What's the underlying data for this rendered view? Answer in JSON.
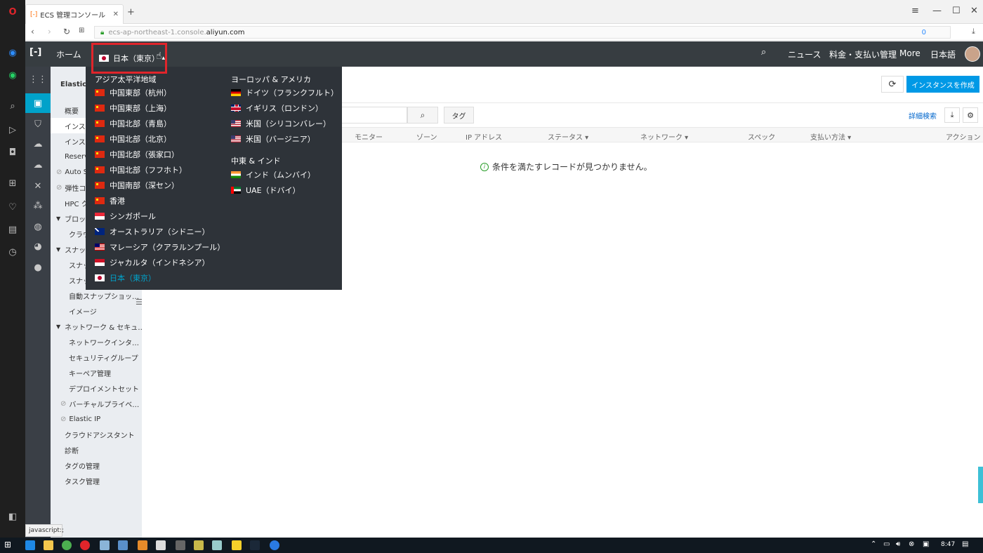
{
  "browser": {
    "tab_title": "ECS 管理コンソール",
    "url_prefix": "ecs-ap-northeast-1.console.",
    "url_domain": "aliyun.com",
    "new_tab": "+",
    "addr_badge": "0"
  },
  "topnav": {
    "home": "ホーム",
    "region_current": "日本（東京）",
    "news": "ニュース",
    "billing": "料金・支払い管理",
    "more": "More",
    "language": "日本語"
  },
  "sidebar": {
    "title": "Elastic C",
    "items": [
      {
        "label": "概要"
      },
      {
        "label": "インス"
      },
      {
        "label": "インス"
      },
      {
        "label": "Reserv"
      },
      {
        "label": "Auto S"
      },
      {
        "label": "弾性コ"
      },
      {
        "label": "HPC ク"
      },
      {
        "label": "ブロッ"
      },
      {
        "label": "クラウ"
      },
      {
        "label": "スナッ"
      },
      {
        "label": "スナッ"
      },
      {
        "label": "スナッ"
      },
      {
        "label": "自動スナップショッ…"
      },
      {
        "label": "イメージ"
      },
      {
        "label": "ネットワーク & セキュ…"
      },
      {
        "label": "ネットワークインタ…"
      },
      {
        "label": "セキュリティグループ"
      },
      {
        "label": "キーペア管理"
      },
      {
        "label": "デプロイメントセット"
      },
      {
        "label": "バーチャルプライベ…"
      },
      {
        "label": "Elastic IP"
      },
      {
        "label": "クラウドアシスタント"
      },
      {
        "label": "診断"
      },
      {
        "label": "タグの管理"
      },
      {
        "label": "タスク管理"
      }
    ]
  },
  "dropdown": {
    "group_asia": "アジア太平洋地域",
    "group_europe": "ヨーロッパ & アメリカ",
    "group_me": "中東 & インド",
    "asia": [
      {
        "label": "中国東部（杭州）",
        "flag": "cn"
      },
      {
        "label": "中国東部（上海）",
        "flag": "cn"
      },
      {
        "label": "中国北部（青島）",
        "flag": "cn"
      },
      {
        "label": "中国北部（北京）",
        "flag": "cn"
      },
      {
        "label": "中国北部（張家口）",
        "flag": "cn"
      },
      {
        "label": "中国北部（フフホト）",
        "flag": "cn"
      },
      {
        "label": "中国南部（深セン）",
        "flag": "cn"
      },
      {
        "label": "香港",
        "flag": "cn"
      },
      {
        "label": "シンガポール",
        "flag": "sg"
      },
      {
        "label": "オーストラリア（シドニー）",
        "flag": "au"
      },
      {
        "label": "マレーシア（クアラルンプール）",
        "flag": "my"
      },
      {
        "label": "ジャカルタ（インドネシア）",
        "flag": "id"
      },
      {
        "label": "日本（東京）",
        "flag": "jp"
      }
    ],
    "europe": [
      {
        "label": "ドイツ（フランクフルト）",
        "flag": "de"
      },
      {
        "label": "イギリス（ロンドン）",
        "flag": "gb"
      },
      {
        "label": "米国（シリコンバレー）",
        "flag": "us"
      },
      {
        "label": "米国（バージニア）",
        "flag": "us"
      }
    ],
    "me": [
      {
        "label": "インド（ムンバイ）",
        "flag": "in"
      },
      {
        "label": "UAE（ドバイ）",
        "flag": "ae"
      }
    ]
  },
  "main": {
    "create_button": "インスタンスを作成",
    "tag_button": "タグ",
    "advanced_search": "詳細検索",
    "columns": [
      "モニター",
      "ゾーン",
      "IP アドレス",
      "ステータス ▾",
      "ネットワーク ▾",
      "スペック",
      "支払い方法 ▾",
      "アクション"
    ],
    "empty_message": "条件を満たすレコードが見つかりません。"
  },
  "statusbar": {
    "text": "javascript:;"
  },
  "taskbar": {
    "time": "8:47"
  }
}
